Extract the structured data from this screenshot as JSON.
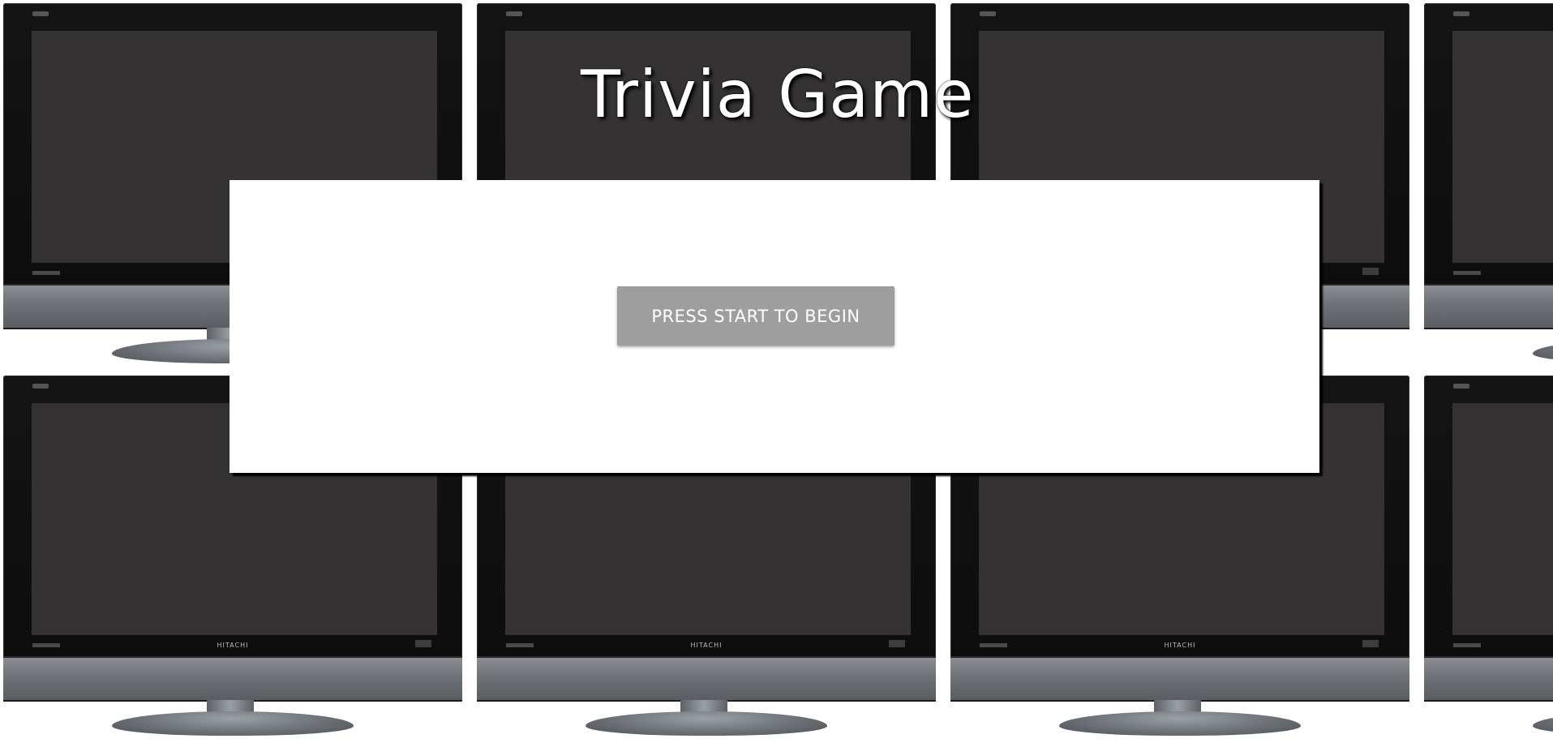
{
  "page": {
    "title": "Trivia Game"
  },
  "background": {
    "description_icon": "tv-wall",
    "tv_brand": "HITACHI"
  },
  "panel": {
    "start_button_label": "PRESS START TO BEGIN"
  },
  "colors": {
    "title_text": "#ffffff",
    "panel_bg": "#ffffff",
    "button_bg": "#9e9e9e",
    "button_text": "#ffffff",
    "tv_screen": "#343232"
  }
}
